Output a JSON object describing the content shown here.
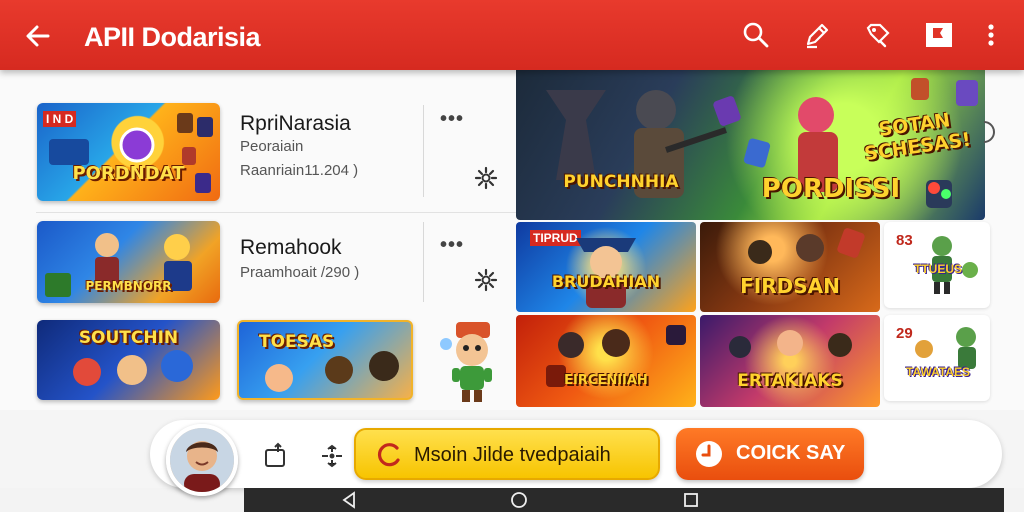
{
  "appbar": {
    "title": "APII Dodarisia",
    "back_icon": "arrow-left-icon",
    "actions": [
      "search-icon",
      "edit-pen-icon",
      "tag-icon",
      "bookmark-flag-icon",
      "more-vertical-icon"
    ]
  },
  "list": {
    "items": [
      {
        "title": "RpriNarasia",
        "subtitle": "Peoraiain",
        "meta": "Raanriain11.204 )",
        "thumb_caption": "PORDNDAT",
        "thumb_badge": "I N D"
      },
      {
        "title": "Remahook",
        "subtitle": "Praamhoait /290 )",
        "thumb_caption": "PERMBNORR"
      }
    ],
    "thumbs_row3": [
      {
        "caption": "SOUTCHIN"
      },
      {
        "caption": "TOESAS"
      }
    ]
  },
  "grid": {
    "hero": {
      "caption_left": "PUNCHNHIA",
      "caption_right": "PORDISSI",
      "caption_corner": "SOTAN SCHESAS!"
    },
    "tiles": [
      {
        "caption": "BRUDAHIAN",
        "badge": "TIPRUD"
      },
      {
        "caption": "FIRDSAN"
      },
      {
        "caption": "EIRCENIIAH"
      },
      {
        "caption": "ERTAKIAKS"
      }
    ],
    "side": [
      {
        "num": "83",
        "caption": "TTUEUS"
      },
      {
        "num": "29",
        "caption": "TAWATAES"
      }
    ]
  },
  "bottom": {
    "primary_label": "Msoin Jilde tvedpaiaih",
    "secondary_label": "COICK SAY"
  },
  "colors": {
    "appbar": "#e03327",
    "primary_button": "#f7c400",
    "secondary_button": "#f0601a"
  }
}
